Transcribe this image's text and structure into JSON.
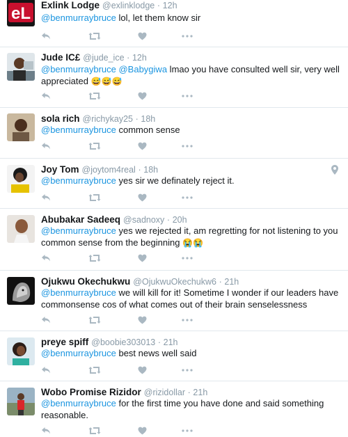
{
  "tweets": [
    {
      "name": "Exlink Lodge",
      "handle": "@exlinklodge",
      "sep": "·",
      "time": "12h",
      "mentions": [
        "@benmurraybruce"
      ],
      "text": " lol, let them know sir",
      "emoji": "",
      "avatar": "logo-avatar"
    },
    {
      "name": "Jude IC£",
      "handle": "@jude_ice",
      "sep": "·",
      "time": "12h",
      "mentions": [
        "@benmurraybruce",
        "@Babygiwa"
      ],
      "text": " lmao you have consulted well sir, very well appreciated",
      "emoji": "😅😅😅",
      "avatar": "photo-avatar"
    },
    {
      "name": "sola rich",
      "handle": "@richykay25",
      "sep": "·",
      "time": "18h",
      "mentions": [
        "@benmurraybruce"
      ],
      "text": " common sense",
      "emoji": "",
      "avatar": "photo-avatar"
    },
    {
      "name": "Joy Tom",
      "handle": "@joytom4real",
      "sep": "·",
      "time": "18h",
      "mentions": [
        "@benmurraybruce"
      ],
      "text": " yes sir we definately reject it.",
      "emoji": "",
      "avatar": "photo-avatar",
      "geo_icon": "location-pin-icon"
    },
    {
      "name": "Abubakar Sadeeq",
      "handle": "@sadnoxy",
      "sep": "·",
      "time": "20h",
      "mentions": [
        "@benmurraybruce"
      ],
      "text": " yes we rejected it, am regretting for not listening to you common sense from the beginning",
      "emoji": "😭😭",
      "avatar": "photo-avatar"
    },
    {
      "name": "Ojukwu Okechukwu",
      "handle": "@OjukwuOkechukw6",
      "sep": "·",
      "time": "21h",
      "mentions": [
        "@benmurraybruce"
      ],
      "text": " we will kill for it! Sometime I wonder if our leaders have commonsense cos of what comes out of their brain  senselessness",
      "emoji": "",
      "avatar": "photo-avatar"
    },
    {
      "name": "preye spiff",
      "handle": "@boobie303013",
      "sep": "·",
      "time": "21h",
      "mentions": [
        "@benmurraybruce"
      ],
      "text": " best news well said",
      "emoji": "",
      "avatar": "photo-avatar"
    },
    {
      "name": "Wobo Promise Rizidor",
      "handle": "@rizidollar",
      "sep": "·",
      "time": "21h",
      "mentions": [
        "@benmurraybruce"
      ],
      "text": " for the first time you have done and said something reasonable.",
      "emoji": "",
      "avatar": "photo-avatar"
    }
  ],
  "action_icons": [
    "reply-icon",
    "retweet-icon",
    "like-icon",
    "more-icon"
  ],
  "colors": {
    "link": "#1b95e0",
    "meta": "#8899a6",
    "icon": "#aab8c2",
    "divider": "#e1e8ed",
    "text": "#14171a",
    "logo_red": "#c8102e"
  }
}
